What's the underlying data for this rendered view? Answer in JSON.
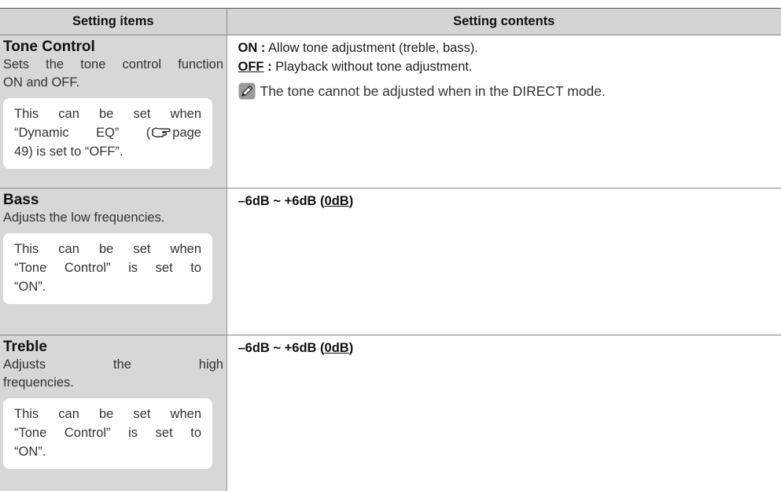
{
  "table": {
    "headers": {
      "item": "Setting items",
      "contents": "Setting contents"
    },
    "rows": [
      {
        "title": "Tone Control",
        "desc_line1": "Sets the tone control function",
        "desc_line2": "ON and OFF.",
        "note_line1": "This can be set when",
        "note_line2a": "“Dynamic EQ” (",
        "note_line2b": "page",
        "note_line3": "49) is set to “OFF”.",
        "contents": {
          "on_key": "ON :",
          "on_text": " Allow tone adjustment (treble, bass).",
          "off_key": "OFF",
          "off_colon": " :",
          "off_text": " Playback without tone adjustment.",
          "hint_text": "The tone cannot be adjusted when in the DIRECT mode."
        }
      },
      {
        "title": "Bass",
        "desc_line1": "Adjusts the low frequencies.",
        "note_line1": "This can be set when",
        "note_line2": "“Tone Control” is set to",
        "note_line3": "“ON”.",
        "range_prefix": "–6dB ~ +6dB (",
        "range_default": "0dB",
        "range_suffix": ")"
      },
      {
        "title": "Treble",
        "desc_line1": "Adjusts the high",
        "desc_line2": "frequencies.",
        "note_line1": "This can be set when",
        "note_line2": "“Tone Control” is set to",
        "note_line3": "“ON”.",
        "range_prefix": "–6dB ~ +6dB (",
        "range_default": "0dB",
        "range_suffix": ")"
      }
    ]
  },
  "icons": {
    "pencil": "pencil-memo-icon",
    "page_ref": "pointing-hand-icon"
  },
  "colors": {
    "header_bg": "#d4d4d4",
    "item_bg": "#d7d7d7"
  }
}
